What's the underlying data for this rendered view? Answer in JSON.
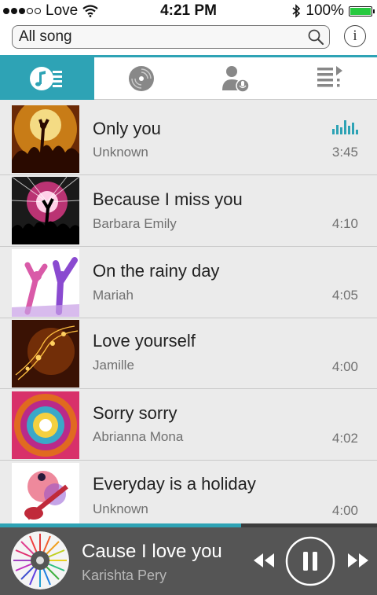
{
  "status": {
    "carrier": "Love",
    "time": "4:21 PM",
    "battery": "100%",
    "battery_level": 1.0
  },
  "search": {
    "value": "All song",
    "search_icon": "magnifier-icon",
    "info_label": "i"
  },
  "tabs": [
    {
      "icon": "songs-list-icon",
      "active": true
    },
    {
      "icon": "album-disc-icon",
      "active": false
    },
    {
      "icon": "artist-mic-icon",
      "active": false
    },
    {
      "icon": "playlist-icon",
      "active": false
    }
  ],
  "songs": [
    {
      "title": "Only you",
      "artist": "Unknown",
      "duration": "3:45",
      "playing": true
    },
    {
      "title": "Because I miss you",
      "artist": "Barbara Emily",
      "duration": "4:10",
      "playing": false
    },
    {
      "title": "On the rainy day",
      "artist": "Mariah",
      "duration": "4:05",
      "playing": false
    },
    {
      "title": "Love yourself",
      "artist": "Jamille",
      "duration": "4:00",
      "playing": false
    },
    {
      "title": "Sorry sorry",
      "artist": "Abrianna Mona",
      "duration": "4:02",
      "playing": false
    },
    {
      "title": "Everyday is a holiday",
      "artist": "Unknown",
      "duration": "4:00",
      "playing": false
    }
  ],
  "now_playing": {
    "title": "Cause I love you",
    "artist": "Karishta Pery",
    "progress": 0.64
  },
  "colors": {
    "accent": "#2ea3b5",
    "player_bg": "#555555"
  }
}
